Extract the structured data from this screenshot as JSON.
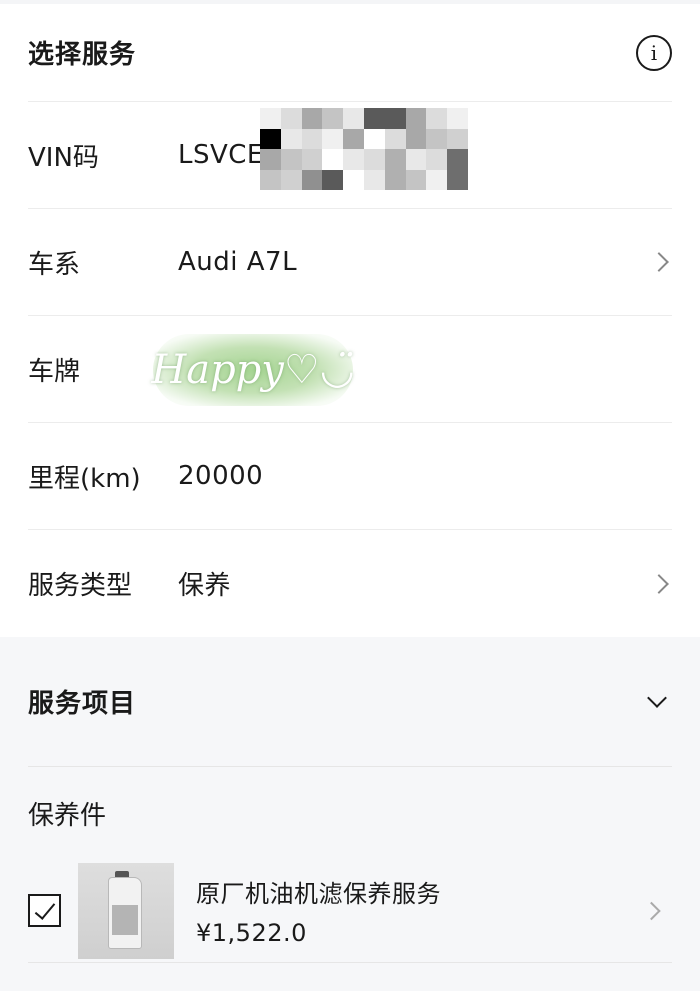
{
  "header": {
    "title": "选择服务",
    "info_icon": "info-icon"
  },
  "form": {
    "vin": {
      "label": "VIN码",
      "value": "LSVCE"
    },
    "series": {
      "label": "车系",
      "value": "Audi A7L"
    },
    "plate": {
      "label": "车牌",
      "sticker_text": "Happy♡◡̈"
    },
    "mileage": {
      "label": "里程(km)",
      "value": "20000"
    },
    "service_type": {
      "label": "服务类型",
      "value": "保养"
    }
  },
  "services": {
    "title": "服务项目",
    "group_label": "保养件",
    "items": [
      {
        "name": "原厂机油机滤保养服务",
        "price": "¥1,522.0",
        "checked": true,
        "image_icon": "oil-bottle-icon"
      }
    ]
  },
  "colors": {
    "divider": "#ececec",
    "bottom_bg": "#f6f7f9",
    "text": "#1a1a1a",
    "chevron": "#888888"
  }
}
